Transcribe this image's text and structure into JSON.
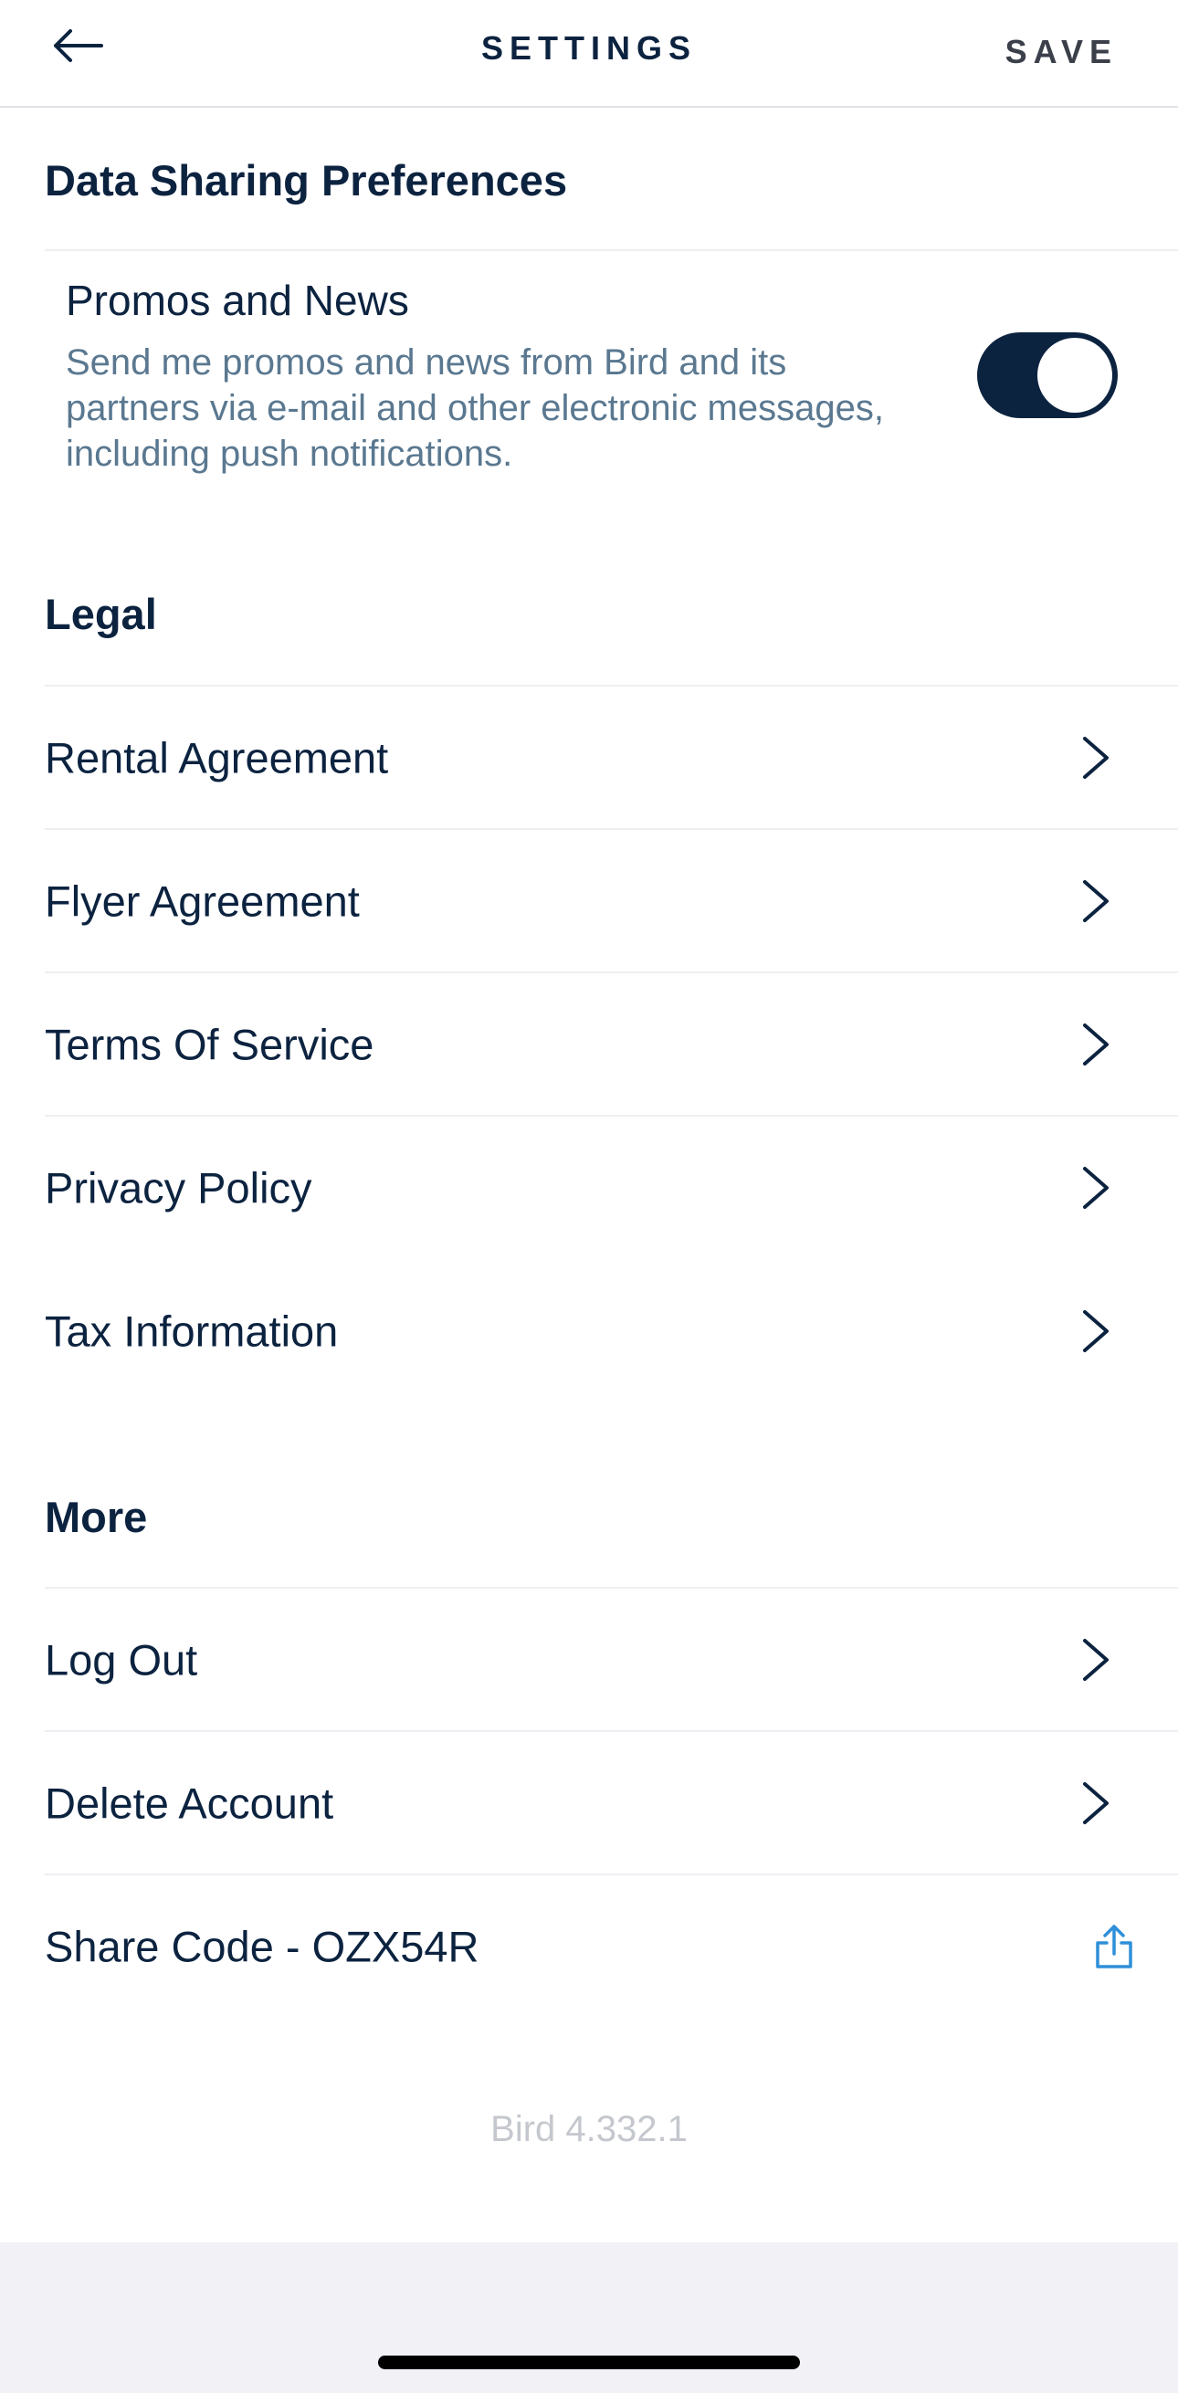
{
  "header": {
    "title": "SETTINGS",
    "save_label": "SAVE",
    "back_icon": "arrow-left-icon"
  },
  "data_sharing": {
    "section_title": "Data Sharing Preferences",
    "promos": {
      "title": "Promos and News",
      "description": "Send me promos and news from Bird and its partners via e-mail and other electronic messages, including push notifications.",
      "enabled": true
    }
  },
  "legal": {
    "section_title": "Legal",
    "items": [
      {
        "label": "Rental Agreement"
      },
      {
        "label": "Flyer Agreement"
      },
      {
        "label": "Terms Of Service"
      },
      {
        "label": "Privacy Policy"
      },
      {
        "label": "Tax Information"
      }
    ]
  },
  "more": {
    "section_title": "More",
    "items": [
      {
        "label": "Log Out"
      },
      {
        "label": "Delete Account"
      },
      {
        "label": "Share Code - OZX54R"
      }
    ]
  },
  "version": "Bird 4.332.1",
  "colors": {
    "primary": "#0c2340",
    "secondary_text": "#5a7890",
    "share_icon": "#2f8fd8",
    "bottom_bar": "#f1f1f6"
  }
}
